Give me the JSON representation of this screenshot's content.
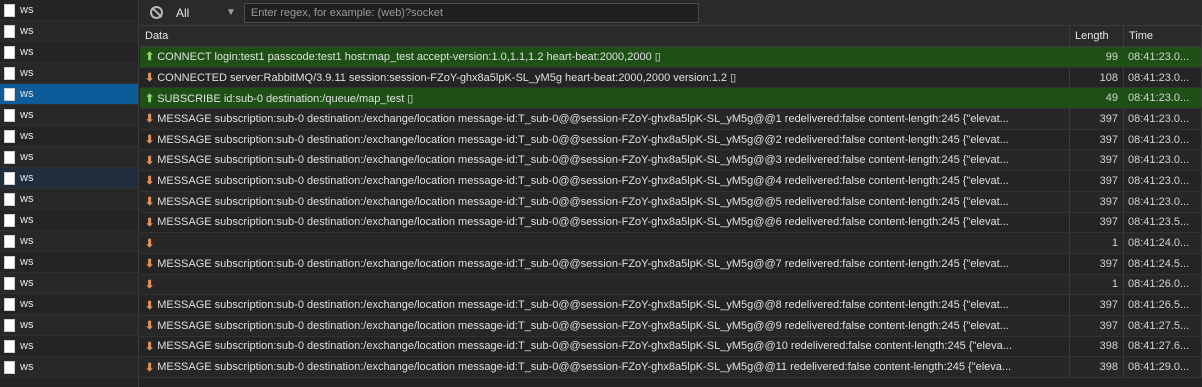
{
  "sidebar": {
    "items": [
      {
        "label": "ws",
        "state": "normal"
      },
      {
        "label": "ws",
        "state": "normal"
      },
      {
        "label": "ws",
        "state": "normal"
      },
      {
        "label": "ws",
        "state": "normal"
      },
      {
        "label": "ws",
        "state": "selected"
      },
      {
        "label": "ws",
        "state": "normal"
      },
      {
        "label": "ws",
        "state": "normal"
      },
      {
        "label": "ws",
        "state": "normal"
      },
      {
        "label": "ws",
        "state": "hover"
      },
      {
        "label": "ws",
        "state": "normal"
      },
      {
        "label": "ws",
        "state": "normal"
      },
      {
        "label": "ws",
        "state": "normal"
      },
      {
        "label": "ws",
        "state": "normal"
      },
      {
        "label": "ws",
        "state": "normal"
      },
      {
        "label": "ws",
        "state": "normal"
      },
      {
        "label": "ws",
        "state": "normal"
      },
      {
        "label": "ws",
        "state": "normal"
      },
      {
        "label": "ws",
        "state": "normal"
      }
    ]
  },
  "toolbar": {
    "clear_icon": "clear-icon",
    "filter_label": "All",
    "dropdown_icon": "▼",
    "search_placeholder": "Enter regex, for example: (web)?socket"
  },
  "table": {
    "headers": {
      "data": "Data",
      "length": "Length",
      "time": "Time"
    },
    "rows": [
      {
        "dir": "sent",
        "arrow": "⬆",
        "data": "CONNECT login:test1 passcode:test1 host:map_test accept-version:1.0,1.1,1.2 heart-beat:2000,2000 ▯",
        "length": "99",
        "time": "08:41:23.0..."
      },
      {
        "dir": "recv",
        "arrow": "⬇",
        "data": "CONNECTED server:RabbitMQ/3.9.11 session:session-FZoY-ghx8a5lpK-SL_yM5g heart-beat:2000,2000 version:1.2 ▯",
        "length": "108",
        "time": "08:41:23.0..."
      },
      {
        "dir": "sent",
        "arrow": "⬆",
        "data": "SUBSCRIBE id:sub-0 destination:/queue/map_test ▯",
        "length": "49",
        "time": "08:41:23.0..."
      },
      {
        "dir": "recv",
        "arrow": "⬇",
        "data": "MESSAGE subscription:sub-0 destination:/exchange/location message-id:T_sub-0@@session-FZoY-ghx8a5lpK-SL_yM5g@@1 redelivered:false content-length:245 {\"elevat...",
        "length": "397",
        "time": "08:41:23.0..."
      },
      {
        "dir": "recv",
        "arrow": "⬇",
        "data": "MESSAGE subscription:sub-0 destination:/exchange/location message-id:T_sub-0@@session-FZoY-ghx8a5lpK-SL_yM5g@@2 redelivered:false content-length:245 {\"elevat...",
        "length": "397",
        "time": "08:41:23.0..."
      },
      {
        "dir": "recv",
        "arrow": "⬇",
        "data": "MESSAGE subscription:sub-0 destination:/exchange/location message-id:T_sub-0@@session-FZoY-ghx8a5lpK-SL_yM5g@@3 redelivered:false content-length:245 {\"elevat...",
        "length": "397",
        "time": "08:41:23.0..."
      },
      {
        "dir": "recv",
        "arrow": "⬇",
        "data": "MESSAGE subscription:sub-0 destination:/exchange/location message-id:T_sub-0@@session-FZoY-ghx8a5lpK-SL_yM5g@@4 redelivered:false content-length:245 {\"elevat...",
        "length": "397",
        "time": "08:41:23.0..."
      },
      {
        "dir": "recv",
        "arrow": "⬇",
        "data": "MESSAGE subscription:sub-0 destination:/exchange/location message-id:T_sub-0@@session-FZoY-ghx8a5lpK-SL_yM5g@@5 redelivered:false content-length:245 {\"elevat...",
        "length": "397",
        "time": "08:41:23.0..."
      },
      {
        "dir": "recv",
        "arrow": "⬇",
        "data": "MESSAGE subscription:sub-0 destination:/exchange/location message-id:T_sub-0@@session-FZoY-ghx8a5lpK-SL_yM5g@@6 redelivered:false content-length:245 {\"elevat...",
        "length": "397",
        "time": "08:41:23.5..."
      },
      {
        "dir": "recv",
        "arrow": "⬇",
        "data": "",
        "length": "1",
        "time": "08:41:24.0..."
      },
      {
        "dir": "recv",
        "arrow": "⬇",
        "data": "MESSAGE subscription:sub-0 destination:/exchange/location message-id:T_sub-0@@session-FZoY-ghx8a5lpK-SL_yM5g@@7 redelivered:false content-length:245 {\"elevat...",
        "length": "397",
        "time": "08:41:24.5..."
      },
      {
        "dir": "recv",
        "arrow": "⬇",
        "data": "",
        "length": "1",
        "time": "08:41:26.0..."
      },
      {
        "dir": "recv",
        "arrow": "⬇",
        "data": "MESSAGE subscription:sub-0 destination:/exchange/location message-id:T_sub-0@@session-FZoY-ghx8a5lpK-SL_yM5g@@8 redelivered:false content-length:245 {\"elevat...",
        "length": "397",
        "time": "08:41:26.5..."
      },
      {
        "dir": "recv",
        "arrow": "⬇",
        "data": "MESSAGE subscription:sub-0 destination:/exchange/location message-id:T_sub-0@@session-FZoY-ghx8a5lpK-SL_yM5g@@9 redelivered:false content-length:245 {\"elevat...",
        "length": "397",
        "time": "08:41:27.5..."
      },
      {
        "dir": "recv",
        "arrow": "⬇",
        "data": "MESSAGE subscription:sub-0 destination:/exchange/location message-id:T_sub-0@@session-FZoY-ghx8a5lpK-SL_yM5g@@10 redelivered:false content-length:245 {\"eleva...",
        "length": "398",
        "time": "08:41:27.6..."
      },
      {
        "dir": "recv",
        "arrow": "⬇",
        "data": "MESSAGE subscription:sub-0 destination:/exchange/location message-id:T_sub-0@@session-FZoY-ghx8a5lpK-SL_yM5g@@11 redelivered:false content-length:245 {\"eleva...",
        "length": "398",
        "time": "08:41:29.0..."
      }
    ]
  },
  "colors": {
    "sent_row": "#1e5015",
    "selected_item": "#0d5c99",
    "arrow_up": "#8fd46f",
    "arrow_down": "#e3915a"
  }
}
